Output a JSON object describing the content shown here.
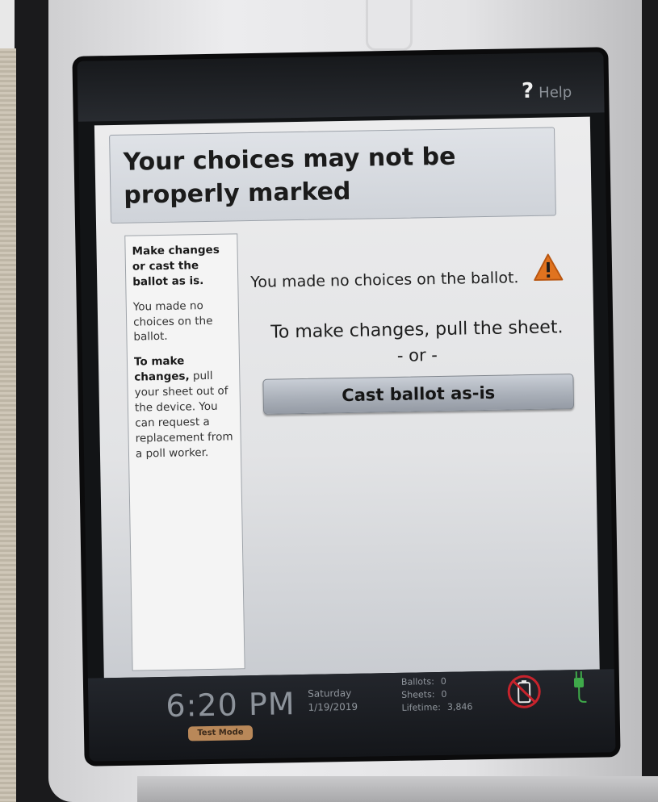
{
  "screen": {
    "help": {
      "icon": "question-mark-icon",
      "symbol": "?",
      "label": "Help"
    },
    "title": "Your choices may not be properly marked",
    "sidebar": {
      "heading": "Make changes or cast the ballot as is.",
      "paragraph1": "You made no choices on the ballot.",
      "paragraph2_bold": "To make changes,",
      "paragraph2_rest": " pull your sheet out of the device. You can request a replacement from a poll worker."
    },
    "main": {
      "message": "You made no choices on the ballot.",
      "warning_icon": "warning-triangle-icon",
      "instruction": "To make changes, pull the sheet.",
      "or": "- or -",
      "cast_button": "Cast ballot as-is"
    },
    "status_bar": {
      "time": "6:20 PM",
      "mode": "Test Mode",
      "day": "Saturday",
      "date": "1/19/2019",
      "ballots_label": "Ballots:",
      "ballots": "0",
      "sheets_label": "Sheets:",
      "sheets": "0",
      "lifetime_label": "Lifetime:",
      "lifetime": "3,846",
      "battery_icon": "no-battery-icon",
      "power_icon": "power-plug-icon"
    }
  },
  "colors": {
    "warning": "#e0731f",
    "no_battery": "#c7232c",
    "plug": "#3faa4a",
    "test_mode": "#b98859"
  }
}
